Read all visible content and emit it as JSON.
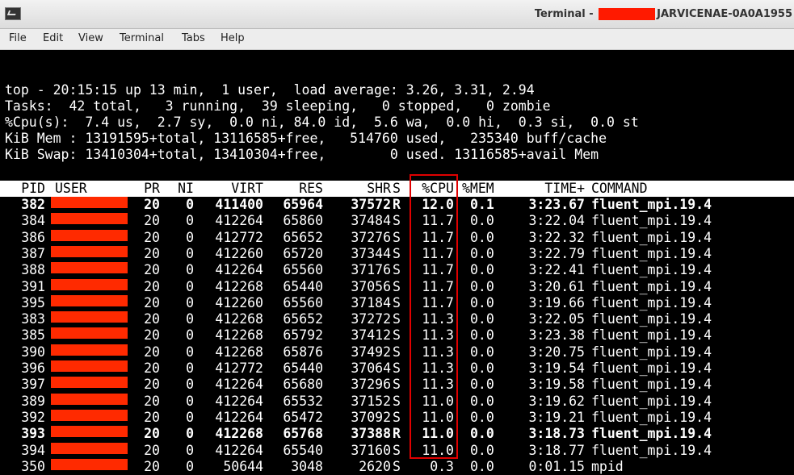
{
  "window": {
    "title_prefix": "Terminal -",
    "title_suffix": "JARVICENAE-0A0A1955"
  },
  "menu": [
    "File",
    "Edit",
    "View",
    "Terminal",
    "Tabs",
    "Help"
  ],
  "summary": [
    "top - 20:15:15 up 13 min,  1 user,  load average: 3.26, 3.31, 2.94",
    "Tasks:  42 total,   3 running,  39 sleeping,   0 stopped,   0 zombie",
    "%Cpu(s):  7.4 us,  2.7 sy,  0.0 ni, 84.0 id,  5.6 wa,  0.0 hi,  0.3 si,  0.0 st",
    "KiB Mem : 13191595+total, 13116585+free,   514760 used,   235340 buff/cache",
    "KiB Swap: 13410304+total, 13410304+free,        0 used. 13116585+avail Mem"
  ],
  "columns": [
    "PID",
    "USER",
    "PR",
    "NI",
    "VIRT",
    "RES",
    "SHR",
    "S",
    "%CPU",
    "%MEM",
    "TIME+",
    "COMMAND"
  ],
  "processes": [
    {
      "pid": "382",
      "pr": "20",
      "ni": "0",
      "virt": "411400",
      "res": "65964",
      "shr": "37572",
      "s": "R",
      "cpu": "12.0",
      "mem": "0.1",
      "time": "3:23.67",
      "cmd": "fluent_mpi.19.4",
      "bold": true
    },
    {
      "pid": "384",
      "pr": "20",
      "ni": "0",
      "virt": "412264",
      "res": "65860",
      "shr": "37484",
      "s": "S",
      "cpu": "11.7",
      "mem": "0.0",
      "time": "3:22.04",
      "cmd": "fluent_mpi.19.4",
      "bold": false
    },
    {
      "pid": "386",
      "pr": "20",
      "ni": "0",
      "virt": "412772",
      "res": "65652",
      "shr": "37276",
      "s": "S",
      "cpu": "11.7",
      "mem": "0.0",
      "time": "3:22.32",
      "cmd": "fluent_mpi.19.4",
      "bold": false
    },
    {
      "pid": "387",
      "pr": "20",
      "ni": "0",
      "virt": "412260",
      "res": "65720",
      "shr": "37344",
      "s": "S",
      "cpu": "11.7",
      "mem": "0.0",
      "time": "3:22.79",
      "cmd": "fluent_mpi.19.4",
      "bold": false
    },
    {
      "pid": "388",
      "pr": "20",
      "ni": "0",
      "virt": "412264",
      "res": "65560",
      "shr": "37176",
      "s": "S",
      "cpu": "11.7",
      "mem": "0.0",
      "time": "3:22.41",
      "cmd": "fluent_mpi.19.4",
      "bold": false
    },
    {
      "pid": "391",
      "pr": "20",
      "ni": "0",
      "virt": "412268",
      "res": "65440",
      "shr": "37056",
      "s": "S",
      "cpu": "11.7",
      "mem": "0.0",
      "time": "3:20.61",
      "cmd": "fluent_mpi.19.4",
      "bold": false
    },
    {
      "pid": "395",
      "pr": "20",
      "ni": "0",
      "virt": "412260",
      "res": "65560",
      "shr": "37184",
      "s": "S",
      "cpu": "11.7",
      "mem": "0.0",
      "time": "3:19.66",
      "cmd": "fluent_mpi.19.4",
      "bold": false
    },
    {
      "pid": "383",
      "pr": "20",
      "ni": "0",
      "virt": "412268",
      "res": "65652",
      "shr": "37272",
      "s": "S",
      "cpu": "11.3",
      "mem": "0.0",
      "time": "3:22.05",
      "cmd": "fluent_mpi.19.4",
      "bold": false
    },
    {
      "pid": "385",
      "pr": "20",
      "ni": "0",
      "virt": "412268",
      "res": "65792",
      "shr": "37412",
      "s": "S",
      "cpu": "11.3",
      "mem": "0.0",
      "time": "3:23.38",
      "cmd": "fluent_mpi.19.4",
      "bold": false
    },
    {
      "pid": "390",
      "pr": "20",
      "ni": "0",
      "virt": "412268",
      "res": "65876",
      "shr": "37492",
      "s": "S",
      "cpu": "11.3",
      "mem": "0.0",
      "time": "3:20.75",
      "cmd": "fluent_mpi.19.4",
      "bold": false
    },
    {
      "pid": "396",
      "pr": "20",
      "ni": "0",
      "virt": "412772",
      "res": "65440",
      "shr": "37064",
      "s": "S",
      "cpu": "11.3",
      "mem": "0.0",
      "time": "3:19.54",
      "cmd": "fluent_mpi.19.4",
      "bold": false
    },
    {
      "pid": "397",
      "pr": "20",
      "ni": "0",
      "virt": "412264",
      "res": "65680",
      "shr": "37296",
      "s": "S",
      "cpu": "11.3",
      "mem": "0.0",
      "time": "3:19.58",
      "cmd": "fluent_mpi.19.4",
      "bold": false
    },
    {
      "pid": "389",
      "pr": "20",
      "ni": "0",
      "virt": "412264",
      "res": "65532",
      "shr": "37152",
      "s": "S",
      "cpu": "11.0",
      "mem": "0.0",
      "time": "3:19.62",
      "cmd": "fluent_mpi.19.4",
      "bold": false
    },
    {
      "pid": "392",
      "pr": "20",
      "ni": "0",
      "virt": "412264",
      "res": "65472",
      "shr": "37092",
      "s": "S",
      "cpu": "11.0",
      "mem": "0.0",
      "time": "3:19.21",
      "cmd": "fluent_mpi.19.4",
      "bold": false
    },
    {
      "pid": "393",
      "pr": "20",
      "ni": "0",
      "virt": "412268",
      "res": "65768",
      "shr": "37388",
      "s": "R",
      "cpu": "11.0",
      "mem": "0.0",
      "time": "3:18.73",
      "cmd": "fluent_mpi.19.4",
      "bold": true
    },
    {
      "pid": "394",
      "pr": "20",
      "ni": "0",
      "virt": "412264",
      "res": "65540",
      "shr": "37160",
      "s": "S",
      "cpu": "11.0",
      "mem": "0.0",
      "time": "3:18.77",
      "cmd": "fluent_mpi.19.4",
      "bold": false
    },
    {
      "pid": "350",
      "pr": "20",
      "ni": "0",
      "virt": "50644",
      "res": "3048",
      "shr": "2620",
      "s": "S",
      "cpu": "0.3",
      "mem": "0.0",
      "time": "0:01.15",
      "cmd": "mpid",
      "bold": false
    }
  ],
  "colors": {
    "redaction": "#ff2a00",
    "highlight_box": "#e00000"
  }
}
